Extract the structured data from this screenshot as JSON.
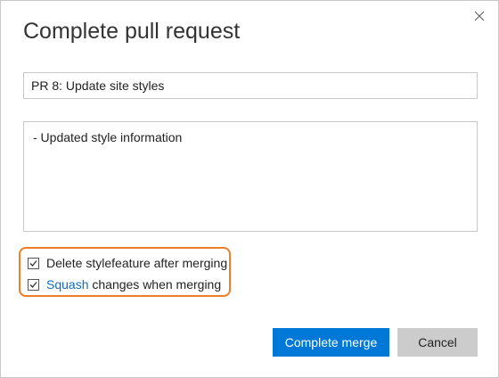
{
  "dialog": {
    "title": "Complete pull request",
    "close_icon": "close-icon"
  },
  "form": {
    "title_value": "PR 8: Update site styles",
    "description_value": "- Updated style information"
  },
  "options": {
    "delete_branch": {
      "checked": true,
      "label": "Delete stylefeature after merging"
    },
    "squash": {
      "checked": true,
      "link_text": "Squash",
      "label_rest": " changes when merging"
    },
    "highlight_color": "#ef7e27"
  },
  "buttons": {
    "complete_label": "Complete merge",
    "cancel_label": "Cancel"
  },
  "colors": {
    "primary": "#0078d7",
    "secondary": "#cccccc",
    "link": "#106ebe"
  }
}
